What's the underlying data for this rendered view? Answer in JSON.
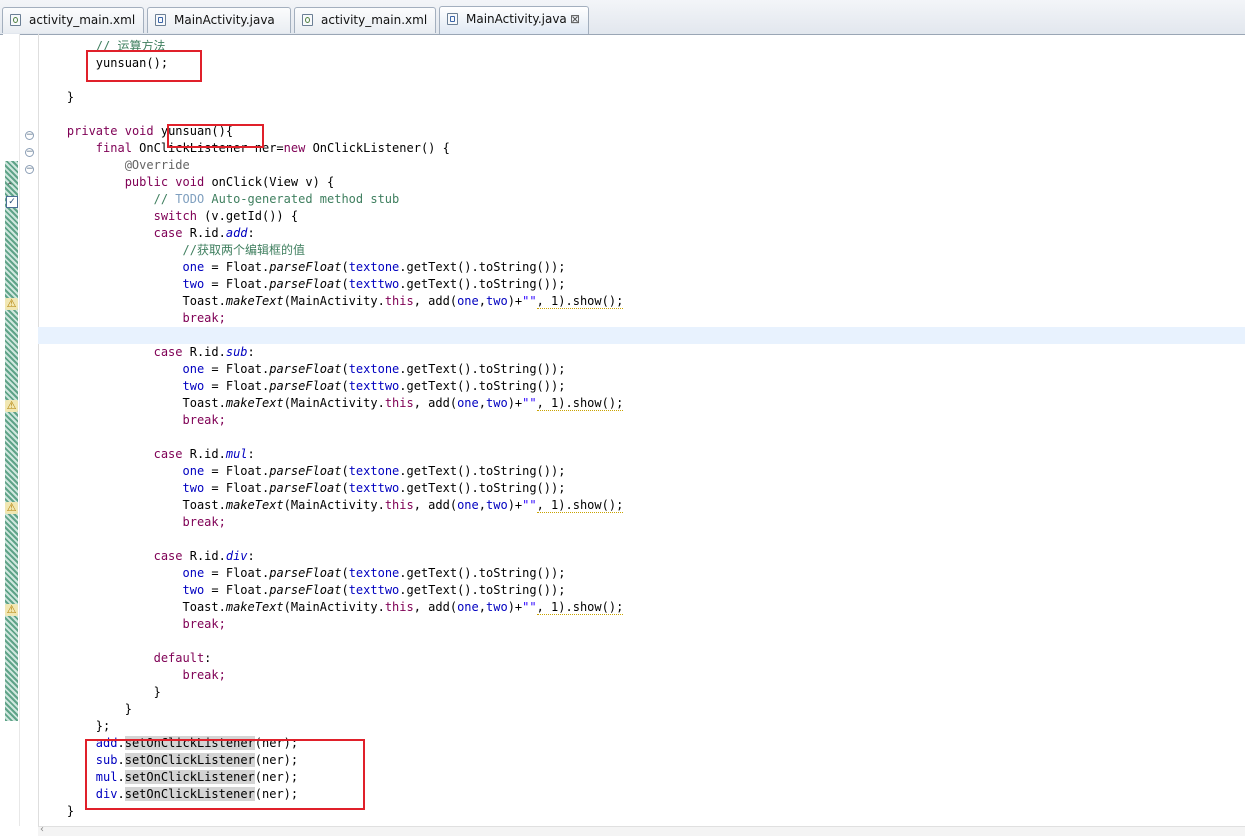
{
  "tabs": [
    {
      "label": "activity_main.xml",
      "icon": "xml-file-icon",
      "active": false
    },
    {
      "label": "MainActivity.java",
      "icon": "java-file-icon",
      "active": false
    },
    {
      "label": "activity_main.xml",
      "icon": "xml-file-icon",
      "active": false
    },
    {
      "label": "MainActivity.java",
      "icon": "java-file-icon",
      "active": true
    }
  ],
  "close_glyph": "⊠",
  "code": {
    "l01": "// 运算方法",
    "l02": "yunsuan();",
    "l04": "}",
    "l06_kw1": "private",
    "l06_kw2": "void",
    "l06_name": "yunsuan(){",
    "l07_kw1": "final",
    "l07_a": "OnClickListener ner=",
    "l07_kw2": "new",
    "l07_b": "OnClickListener() {",
    "l08": "@Override",
    "l09_kw1": "public",
    "l09_kw2": "void",
    "l09_b": "onClick(View v) {",
    "l10_a": "// ",
    "l10_todo": "TODO",
    "l10_b": " Auto-generated method stub",
    "l11_kw": "switch",
    "l11_b": " (v.getId()) {",
    "case_kw": "case",
    "rid": " R.id.",
    "colon": ":",
    "l12_id": "add",
    "l13": "//获取两个编辑框的值",
    "one": "one",
    "two": "two",
    "eq_float": " = Float.",
    "parse": "parseFloat",
    "paren": "(",
    "textone": "textone",
    "texttwo": "texttwo",
    "gettext": ".getText().toString());",
    "toast": "Toast.",
    "maketext": "makeText",
    "ma": "(MainActivity.",
    "this_kw": "this",
    "add_call": ", add(",
    "comma": ",",
    "close_plus": ")+",
    "empty_str": "\"\"",
    "show": ", 1).show();",
    "break_kw": "break;",
    "l20_id": "sub",
    "l26_id": "mul",
    "l32_id": "div",
    "default_kw": "default",
    "brace_close": "}",
    "anon_close": "};",
    "listeners": [
      {
        "field": "add",
        "call": "setOnClickListener",
        "arg": "(ner);"
      },
      {
        "field": "sub",
        "call": "setOnClickListener",
        "arg": "(ner);"
      },
      {
        "field": "mul",
        "call": "setOnClickListener",
        "arg": "(ner);"
      },
      {
        "field": "div",
        "call": "setOnClickListener",
        "arg": "(ner);"
      }
    ],
    "final_brace": "}"
  },
  "colors": {
    "keyword": "#7f0055",
    "field": "#0000c0",
    "comment": "#3f7f5f",
    "string": "#2a00ff",
    "annotation": "#646464",
    "highlight_box": "#e0202a",
    "current_line": "#e8f2fe"
  }
}
